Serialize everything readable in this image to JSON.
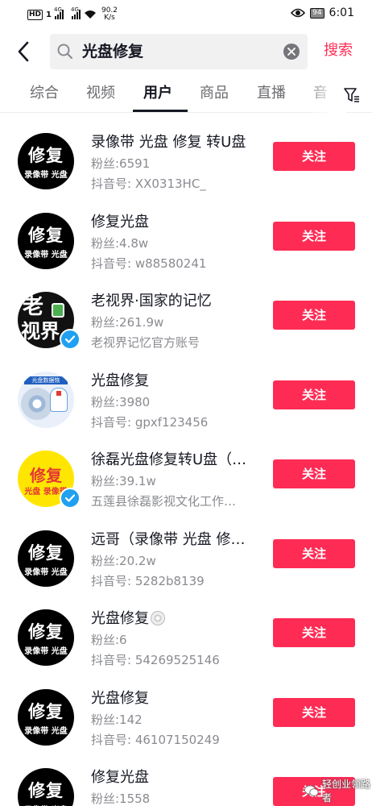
{
  "status_bar": {
    "network_badge": "HD",
    "sim1": "1",
    "signal1": "4G",
    "signal2": "4G",
    "speed_value": "90.2",
    "speed_unit": "K/s",
    "battery": "94",
    "time": "6:01"
  },
  "search": {
    "query": "光盘修复",
    "submit_label": "搜索"
  },
  "tabs": [
    {
      "label": "综合",
      "active": false
    },
    {
      "label": "视频",
      "active": false
    },
    {
      "label": "用户",
      "active": true
    },
    {
      "label": "商品",
      "active": false
    },
    {
      "label": "直播",
      "active": false
    },
    {
      "label": "音",
      "active": false
    }
  ],
  "users": [
    {
      "name": "录像带 光盘 修复 转U盘",
      "fans": "粉丝:6591",
      "sub": "抖音号: XX0313HC_",
      "follow": "关注",
      "avatar_top": "修复",
      "avatar_bottom": "录像带 光盘",
      "avatar_style": "black",
      "verified": false
    },
    {
      "name": "修复光盘",
      "fans": "粉丝:4.8w",
      "sub": "抖音号: w88580241",
      "follow": "关注",
      "avatar_top": "修复",
      "avatar_bottom": "录像带 光盘",
      "avatar_style": "black",
      "verified": false
    },
    {
      "name": "老视界·国家的记忆",
      "fans": "粉丝:261.9w",
      "sub": "老视界记忆官方账号",
      "follow": "关注",
      "avatar_top": "老",
      "avatar_bottom": "视界",
      "avatar_style": "lsj",
      "verified": true
    },
    {
      "name": "光盘修复",
      "fans": "粉丝:3980",
      "sub": "抖音号: gpxf123456",
      "follow": "关注",
      "avatar_top": "光盘数据恢",
      "avatar_bottom": "",
      "avatar_style": "disc",
      "verified": false
    },
    {
      "name": "徐磊光盘修复转U盘（…",
      "fans": "粉丝:39.1w",
      "sub": "五莲县徐磊影视文化工作…",
      "follow": "关注",
      "avatar_top": "修复",
      "avatar_bottom": "光盘 录像带",
      "avatar_style": "yellow",
      "verified": true
    },
    {
      "name": "远哥（录像带 光盘 修…",
      "fans": "粉丝:20.2w",
      "sub": "抖音号: 5282b8139",
      "follow": "关注",
      "avatar_top": "修复",
      "avatar_bottom": "录像带 光盘",
      "avatar_style": "black",
      "verified": false
    },
    {
      "name": "光盘修复",
      "fans": "粉丝:6",
      "sub": "抖音号: 54269525146",
      "follow": "关注",
      "avatar_top": "修复",
      "avatar_bottom": "录像带 光盘",
      "avatar_style": "black",
      "verified": false,
      "disc_emoji": true
    },
    {
      "name": "光盘修复",
      "fans": "粉丝:142",
      "sub": "抖音号: 46107150249",
      "follow": "关注",
      "avatar_top": "修复",
      "avatar_bottom": "录像带 光盘",
      "avatar_style": "black",
      "verified": false
    },
    {
      "name": "修复光盘",
      "fans": "粉丝:1558",
      "sub": "",
      "follow": "关注",
      "avatar_top": "修复",
      "avatar_bottom": "录像带 光盘",
      "avatar_style": "black",
      "verified": false
    }
  ],
  "watermark": "轻创业领路者",
  "colors": {
    "accent": "#fe2c55",
    "secondary_text": "#8a8b91",
    "verified": "#20a0f0"
  }
}
